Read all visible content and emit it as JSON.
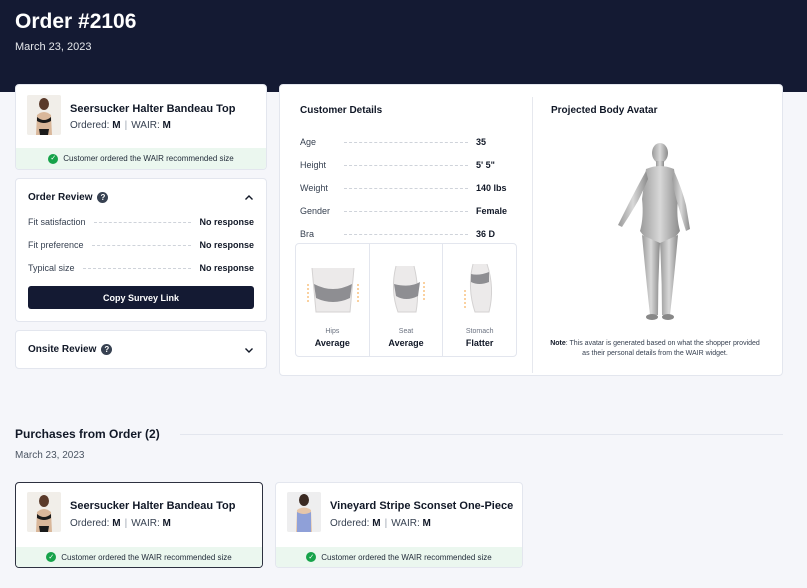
{
  "order": {
    "title": "Order #2106",
    "date": "March 23, 2023"
  },
  "selected_product": {
    "name": "Seersucker Halter Bandeau Top",
    "ordered_label": "Ordered:",
    "ordered_size": "M",
    "wair_label": "WAIR:",
    "wair_size": "M",
    "recommendation": "Customer ordered the WAIR recommended size"
  },
  "order_review": {
    "title": "Order Review",
    "rows": [
      {
        "label": "Fit satisfaction",
        "value": "No response"
      },
      {
        "label": "Fit preference",
        "value": "No response"
      },
      {
        "label": "Typical size",
        "value": "No response"
      }
    ],
    "button_label": "Copy Survey Link"
  },
  "onsite_review": {
    "title": "Onsite Review"
  },
  "customer_details": {
    "title": "Customer Details",
    "rows": [
      {
        "label": "Age",
        "value": "35"
      },
      {
        "label": "Height",
        "value": "5' 5\""
      },
      {
        "label": "Weight",
        "value": "140 lbs"
      },
      {
        "label": "Gender",
        "value": "Female"
      },
      {
        "label": "Bra",
        "value": "36 D"
      }
    ],
    "shapes": [
      {
        "label": "Hips",
        "value": "Average"
      },
      {
        "label": "Seat",
        "value": "Average"
      },
      {
        "label": "Stomach",
        "value": "Flatter"
      }
    ]
  },
  "avatar": {
    "title": "Projected Body Avatar",
    "note_label": "Note",
    "note_text": ": This avatar is generated based on what the shopper provided as their personal details from the WAIR widget."
  },
  "purchases": {
    "title": "Purchases from Order (2)",
    "date": "March 23, 2023",
    "items": [
      {
        "name": "Seersucker Halter Bandeau Top",
        "ordered_label": "Ordered:",
        "ordered_size": "M",
        "wair_label": "WAIR:",
        "wair_size": "M",
        "recommendation": "Customer ordered the WAIR recommended size"
      },
      {
        "name": "Vineyard Stripe Sconset One-Piece",
        "ordered_label": "Ordered:",
        "ordered_size": "M",
        "wair_label": "WAIR:",
        "wair_size": "M",
        "recommendation": "Customer ordered the WAIR recommended size"
      }
    ]
  },
  "colors": {
    "header_bg": "#141a33",
    "success": "#16a34a",
    "success_bg": "#ebf7ef",
    "button_bg": "#141a33"
  }
}
